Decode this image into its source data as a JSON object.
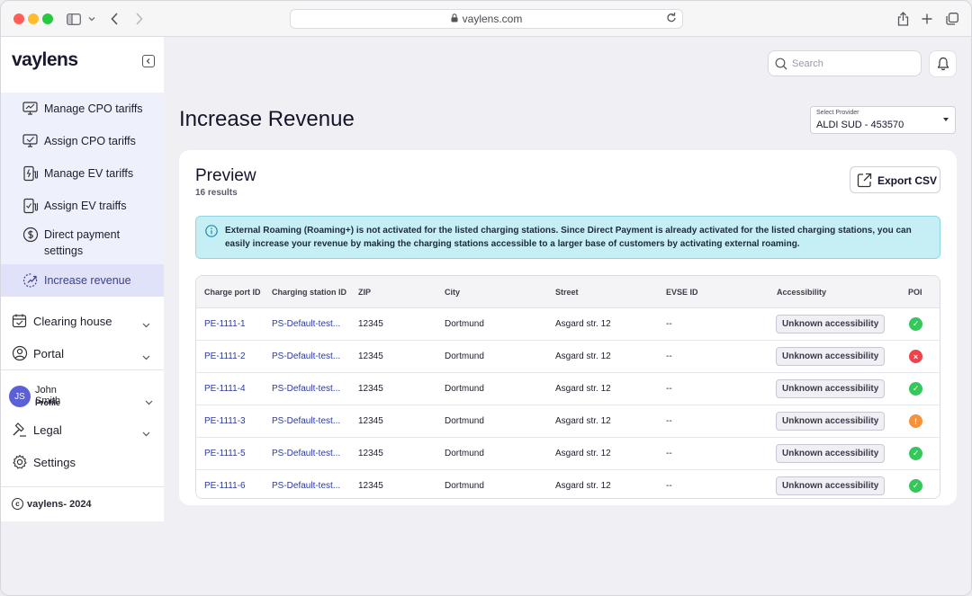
{
  "browser": {
    "url": "vaylens.com"
  },
  "sidebar": {
    "logo": "vaylens",
    "subitems": [
      {
        "label": "Manage CPO tariffs",
        "icon": "tariff-monitor-icon"
      },
      {
        "label": "Assign CPO tariffs",
        "icon": "assign-monitor-icon"
      },
      {
        "label": "Manage EV tariffs",
        "icon": "ev-charger-icon"
      },
      {
        "label": "Assign EV traiffs",
        "icon": "ev-assign-icon"
      },
      {
        "label": "Direct payment settings",
        "icon": "dollar-icon"
      },
      {
        "label": "Increase revenue",
        "icon": "growth-icon",
        "active": true
      }
    ],
    "items": [
      {
        "label": "Clearing house",
        "icon": "clearing-house-icon"
      },
      {
        "label": "Portal",
        "icon": "portal-icon"
      }
    ],
    "user": {
      "initials": "JS",
      "name": "John Smith",
      "role": "Profile"
    },
    "bottom_items": [
      {
        "label": "Legal",
        "icon": "gavel-icon"
      },
      {
        "label": "Settings",
        "icon": "gear-icon"
      }
    ],
    "footer": "vaylens- 2024"
  },
  "topbar": {
    "search_placeholder": "Search"
  },
  "page": {
    "title": "Increase Revenue",
    "provider_caption": "Select Provider",
    "provider_value": "ALDI SUD - 453570"
  },
  "card": {
    "title": "Preview",
    "subtitle": "16 results",
    "export_label": "Export CSV",
    "alert": "External Roaming (Roaming+) is not activated for the listed charging stations. Since Direct Payment is already activated for the listed charging stations, you can easily increase your revenue by making the charging stations accessible to a larger base of customers by activating external roaming."
  },
  "table": {
    "columns": [
      "Charge port ID",
      "Charging station ID",
      "ZIP",
      "City",
      "Street",
      "EVSE ID",
      "Accessibility",
      "POI"
    ],
    "rows": [
      {
        "port": "PE-1111-1",
        "station": "PS-Default-test...",
        "zip": "12345",
        "city": "Dortmund",
        "street": "Asgard str. 12",
        "evse": "--",
        "access": "Unknown accessibility",
        "poi": "ok"
      },
      {
        "port": "PE-1111-2",
        "station": "PS-Default-test...",
        "zip": "12345",
        "city": "Dortmund",
        "street": "Asgard str. 12",
        "evse": "--",
        "access": "Unknown accessibility",
        "poi": "error"
      },
      {
        "port": "PE-1111-4",
        "station": "PS-Default-test...",
        "zip": "12345",
        "city": "Dortmund",
        "street": "Asgard str. 12",
        "evse": "--",
        "access": "Unknown accessibility",
        "poi": "ok"
      },
      {
        "port": "PE-1111-3",
        "station": "PS-Default-test...",
        "zip": "12345",
        "city": "Dortmund",
        "street": "Asgard str. 12",
        "evse": "--",
        "access": "Unknown accessibility",
        "poi": "warning"
      },
      {
        "port": "PE-1111-5",
        "station": "PS-Default-test...",
        "zip": "12345",
        "city": "Dortmund",
        "street": "Asgard str. 12",
        "evse": "--",
        "access": "Unknown accessibility",
        "poi": "ok"
      },
      {
        "port": "PE-1111-6",
        "station": "PS-Default-test...",
        "zip": "12345",
        "city": "Dortmund",
        "street": "Asgard str. 12",
        "evse": "--",
        "access": "Unknown accessibility",
        "poi": "ok"
      }
    ]
  },
  "colors": {
    "accent": "#5b60d6",
    "link": "#2c3a9e",
    "poi_ok": "#34c759",
    "poi_error": "#f0424b",
    "poi_warning": "#f5923a",
    "alert_bg": "#c6eff5"
  }
}
